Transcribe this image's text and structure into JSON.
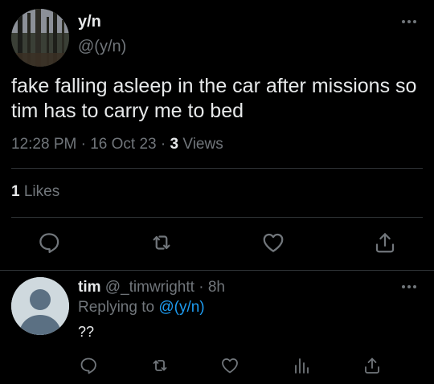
{
  "tweet": {
    "author_name": "y/n",
    "author_handle": "@(y/n)",
    "text": "fake falling asleep in the car after missions so tim has to carry me to bed",
    "time": "12:28 PM",
    "sep": "·",
    "date": "16 Oct 23",
    "views_count": "3",
    "views_label": "Views",
    "likes_count": "1",
    "likes_label": "Likes"
  },
  "reply": {
    "author_name": "tim",
    "author_handle": "@_timwrightt",
    "sep": "·",
    "age": "8h",
    "replying_prefix": "Replying to",
    "replying_to": "@(y/n)",
    "text": "??"
  },
  "icons": {
    "tweet_actions": [
      "reply-icon",
      "retweet-icon",
      "like-icon",
      "share-icon"
    ],
    "reply_actions": [
      "reply-icon",
      "retweet-icon",
      "like-icon",
      "analytics-icon",
      "share-icon"
    ],
    "more": "more-icon"
  },
  "colors": {
    "background": "#000000",
    "text": "#e7e9ea",
    "muted": "#71767b",
    "link": "#1d9bf0",
    "divider": "#2f3336"
  }
}
